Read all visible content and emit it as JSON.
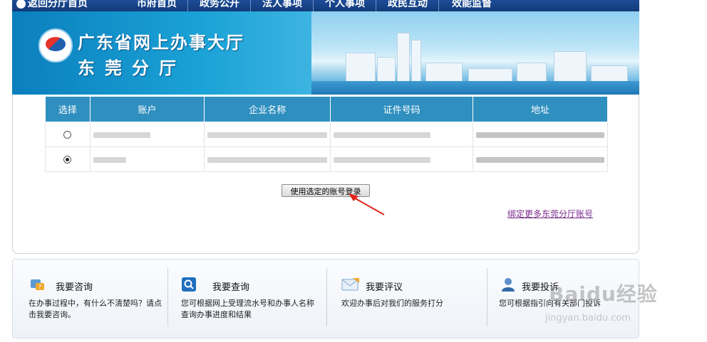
{
  "header": {
    "back_label": "返回分厅首页",
    "nav": [
      "市府首页",
      "政务公开",
      "法人事项",
      "个人事项",
      "政民互动",
      "效能监督"
    ],
    "title_line1": "广东省网上办事大厅",
    "title_line2": "东莞分厅"
  },
  "accounts": {
    "columns": [
      "选择",
      "账户",
      "企业名称",
      "证件号码",
      "地址"
    ],
    "rows": [
      {
        "selected": false
      },
      {
        "selected": true
      }
    ]
  },
  "actions": {
    "login_label": "使用选定的账号登录",
    "bind_more_label": "绑定更多东莞分厅账号"
  },
  "services": [
    {
      "title": "我要咨询",
      "desc": "在办事过程中，有什么不清楚吗？请点击我要咨询。",
      "icon": "consult-icon"
    },
    {
      "title": "我要查询",
      "desc": "您可根据网上受理流水号和办事人名称查询办事进度和结果",
      "icon": "search-icon"
    },
    {
      "title": "我要评议",
      "desc": "欢迎办事后对我们的服务打分",
      "icon": "mail-icon"
    },
    {
      "title": "我要投诉",
      "desc": "您可根据指引向有关部门投诉",
      "icon": "user-icon"
    }
  ],
  "watermark": {
    "brand": "Baidu经验",
    "site": "jingyan.baidu.com"
  },
  "colors": {
    "nav_bg": "#1d4d96",
    "table_header": "#2f8fbf",
    "link": "#7b2b8c"
  }
}
